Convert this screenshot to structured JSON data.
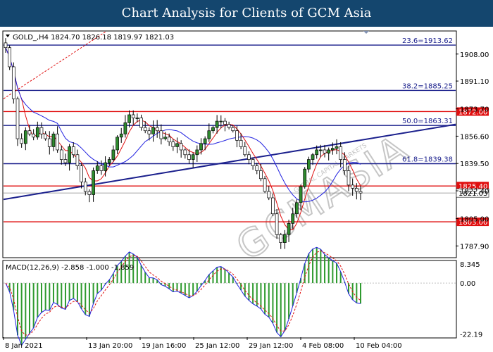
{
  "banner": {
    "title": "Chart Analysis for Clients of GCM Asia"
  },
  "watermark": "GCMASIA",
  "watermark_small": "GLOBAL CAPITAL MARKETS",
  "chart_data": {
    "type": "candlestick",
    "symbol_line": "GOLD_,H4  1824.70 1826.18 1819.97 1821.03",
    "price_ticks": [
      "1908.00",
      "1891.10",
      "1873.70",
      "1856.60",
      "1839.50",
      "1822.40",
      "1805.00",
      "1787.90"
    ],
    "price_tick_values": [
      1908.0,
      1891.1,
      1873.7,
      1856.6,
      1839.5,
      1822.4,
      1805.0,
      1787.9
    ],
    "ylim": [
      1781,
      1922
    ],
    "x_labels": [
      "8 Jan 2021",
      "13 Jan 20:00",
      "19 Jan 16:00",
      "25 Jan 12:00",
      "29 Jan 12:00",
      "4 Feb 08:00",
      "10 Feb 04:00"
    ],
    "fib_levels": [
      {
        "label": "23.6=1913.62",
        "value": 1913.62
      },
      {
        "label": "38.2=1885.25",
        "value": 1885.25
      },
      {
        "label": "50.0=1863.31",
        "value": 1863.31
      },
      {
        "label": "61.8=1839.38",
        "value": 1839.38
      }
    ],
    "sr_levels": [
      {
        "label": "1872.00",
        "value": 1872.0
      },
      {
        "label": "1825.40",
        "value": 1825.4
      },
      {
        "label": "1803.00",
        "value": 1803.0
      }
    ],
    "current_price": {
      "label": "1821.03",
      "value": 1821.03
    },
    "trendline": {
      "from": [
        0,
        1817
      ],
      "to": [
        1,
        1864
      ]
    },
    "close_path": [
      1912,
      1900,
      1880,
      1855,
      1852,
      1860,
      1858,
      1856,
      1862,
      1858,
      1855,
      1850,
      1858,
      1848,
      1842,
      1840,
      1850,
      1845,
      1838,
      1828,
      1822,
      1820,
      1835,
      1838,
      1835,
      1840,
      1842,
      1848,
      1856,
      1858,
      1865,
      1870,
      1868,
      1868,
      1862,
      1860,
      1858,
      1862,
      1860,
      1855,
      1856,
      1853,
      1850,
      1852,
      1848,
      1845,
      1842,
      1845,
      1848,
      1852,
      1855,
      1860,
      1862,
      1866,
      1866,
      1864,
      1862,
      1860,
      1854,
      1850,
      1845,
      1842,
      1838,
      1835,
      1830,
      1822,
      1818,
      1808,
      1795,
      1790,
      1795,
      1802,
      1808,
      1815,
      1825,
      1836,
      1842,
      1845,
      1848,
      1848,
      1846,
      1848,
      1849,
      1850,
      1842,
      1835,
      1826,
      1824,
      1822,
      1821
    ],
    "macd": {
      "label": "MACD(12,26,9) -2.858 -1.000 -1.859",
      "ticks": [
        "8.345",
        "0.00",
        "-22.19"
      ],
      "tick_values": [
        8.345,
        0.0,
        -22.19
      ],
      "ylim": [
        -23.5,
        9.5
      ]
    }
  }
}
